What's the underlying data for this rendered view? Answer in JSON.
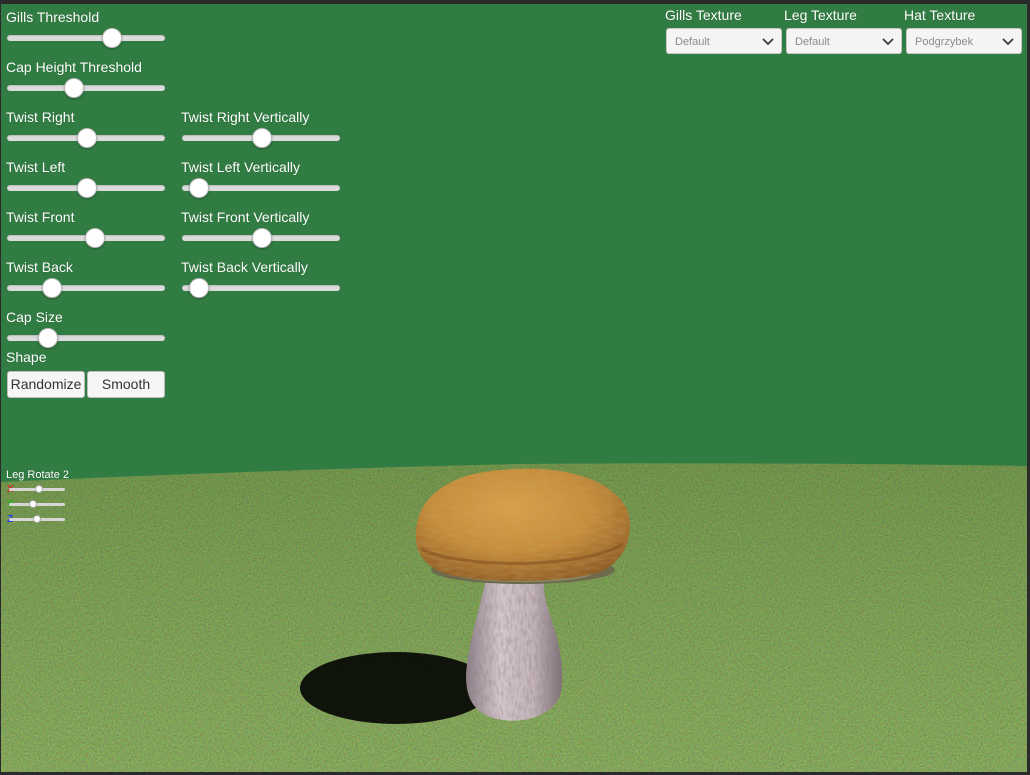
{
  "left_panel": {
    "sliders": [
      {
        "label": "Gills Threshold",
        "value": 0.68
      },
      {
        "label": "Cap Height Threshold",
        "value": 0.41
      },
      {
        "label": "Twist Right",
        "value": 0.5
      },
      {
        "label": "Twist Left",
        "value": 0.5
      },
      {
        "label": "Twist Front",
        "value": 0.56
      },
      {
        "label": "Twist Back",
        "value": 0.25
      },
      {
        "label": "Cap Size",
        "value": 0.22
      }
    ],
    "sliders_right": [
      {
        "label": "Twist Right Vertically",
        "value": 0.5
      },
      {
        "label": "Twist Left Vertically",
        "value": 0.05
      },
      {
        "label": "Twist Front Vertically",
        "value": 0.5
      },
      {
        "label": "Twist Back Vertically",
        "value": 0.05
      }
    ],
    "shape": {
      "label": "Shape",
      "randomize_label": "Randomize",
      "smooth_label": "Smooth"
    }
  },
  "textures": [
    {
      "label": "Gills Texture",
      "selected": "Default",
      "icon": "chevron-down-icon"
    },
    {
      "label": "Leg Texture",
      "selected": "Default",
      "icon": "chevron-down-icon"
    },
    {
      "label": "Hat Texture",
      "selected": "Podgrzybek",
      "icon": "chevron-down-icon"
    }
  ],
  "leg_rotate": {
    "label": "Leg Rotate 2",
    "axes": [
      {
        "name": "X",
        "color": "#e02020",
        "value": 0.55
      },
      {
        "name": "Y",
        "color": "#20c020",
        "value": 0.42
      },
      {
        "name": "Z",
        "color": "#2040ff",
        "value": 0.5
      }
    ]
  },
  "colors": {
    "sky": "#317c42",
    "ground": "#4e6e28",
    "cap": "#c9913f",
    "stem": "#c4b5bd",
    "ui_track": "#dcdcdc"
  }
}
